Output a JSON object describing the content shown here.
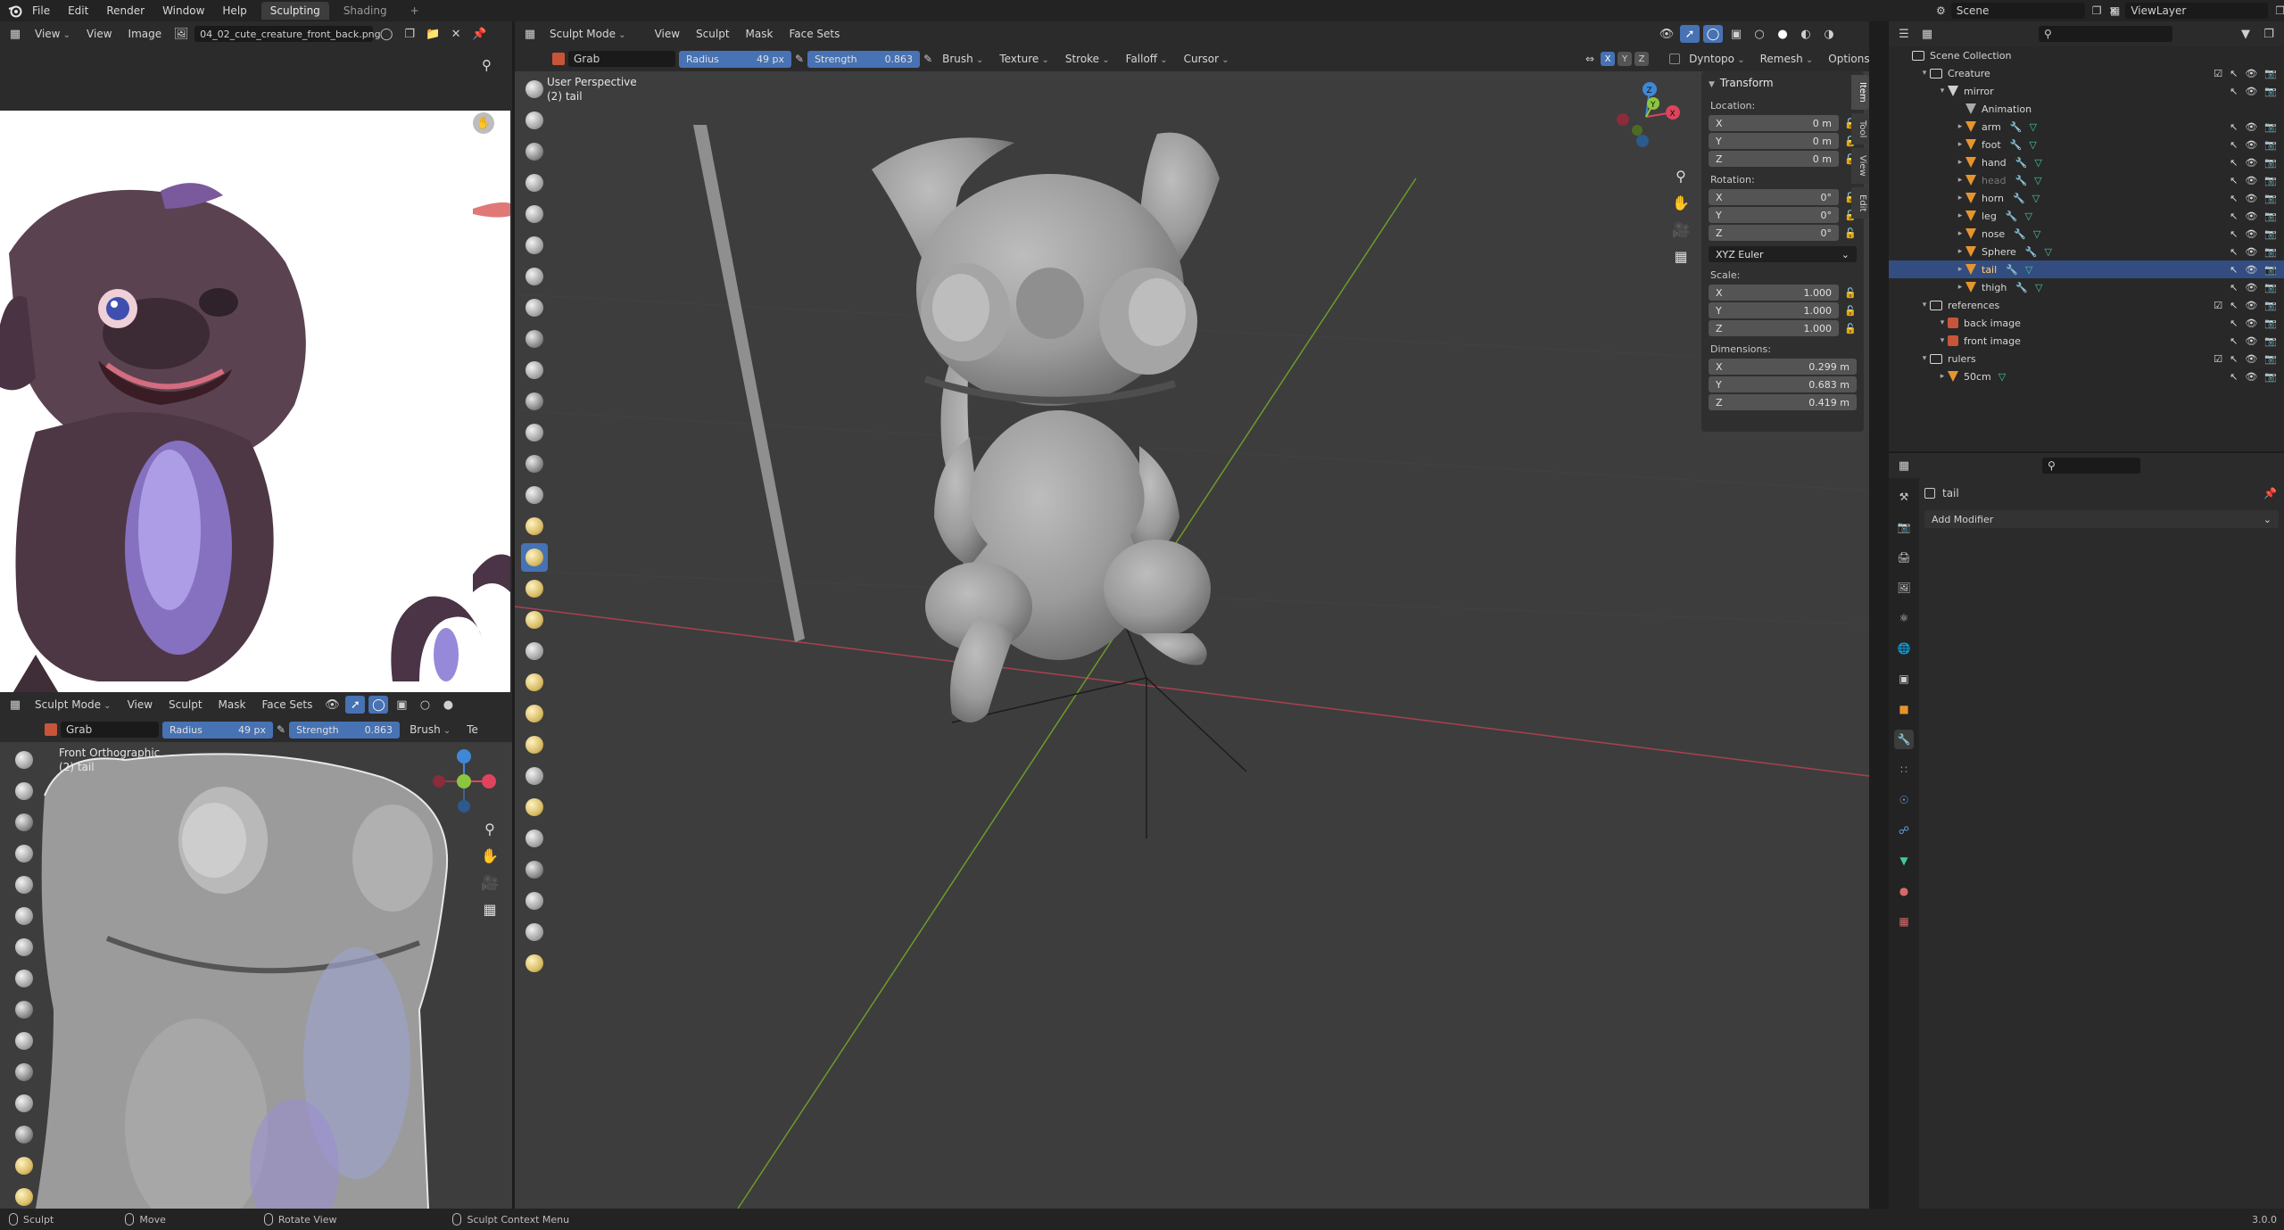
{
  "topbar": {
    "menus": [
      "File",
      "Edit",
      "Render",
      "Window",
      "Help"
    ],
    "workspace_tabs": [
      "Sculpting",
      "Shading"
    ],
    "add_tab": "+",
    "scene": "Scene",
    "view_layer": "ViewLayer"
  },
  "image_editor": {
    "view": "View",
    "menus": [
      "View",
      "Image"
    ],
    "image_name": "04_02_cute_creature_front_back.png"
  },
  "small_viewport": {
    "mode": "Sculpt Mode",
    "menus": [
      "View",
      "Sculpt",
      "Mask",
      "Face Sets"
    ],
    "brush": "Grab",
    "radius_label": "Radius",
    "radius_value": "49 px",
    "strength_label": "Strength",
    "strength_value": "0.863",
    "brush_menu": "Brush",
    "texture_menu": "Te",
    "view_name": "Front Orthographic",
    "object_name": "(2) tail"
  },
  "main_viewport": {
    "mode": "Sculpt Mode",
    "menus": [
      "View",
      "Sculpt",
      "Mask",
      "Face Sets"
    ],
    "brush": "Grab",
    "radius_label": "Radius",
    "radius_value": "49 px",
    "strength_label": "Strength",
    "strength_value": "0.863",
    "dropdowns": [
      "Brush",
      "Texture",
      "Stroke",
      "Falloff",
      "Cursor"
    ],
    "symmetry": [
      "X",
      "Y",
      "Z"
    ],
    "dyntopo": "Dyntopo",
    "remesh": "Remesh",
    "options": "Options",
    "view_name": "User Perspective",
    "object_name": "(2) tail"
  },
  "transform_panel": {
    "title": "Transform",
    "location_label": "Location:",
    "location": [
      {
        "axis": "X",
        "value": "0 m"
      },
      {
        "axis": "Y",
        "value": "0 m"
      },
      {
        "axis": "Z",
        "value": "0 m"
      }
    ],
    "rotation_label": "Rotation:",
    "rotation": [
      {
        "axis": "X",
        "value": "0°"
      },
      {
        "axis": "Y",
        "value": "0°"
      },
      {
        "axis": "Z",
        "value": "0°"
      }
    ],
    "rotation_mode": "XYZ Euler",
    "scale_label": "Scale:",
    "scale": [
      {
        "axis": "X",
        "value": "1.000"
      },
      {
        "axis": "Y",
        "value": "1.000"
      },
      {
        "axis": "Z",
        "value": "1.000"
      }
    ],
    "dimensions_label": "Dimensions:",
    "dimensions": [
      {
        "axis": "X",
        "value": "0.299 m"
      },
      {
        "axis": "Y",
        "value": "0.683 m"
      },
      {
        "axis": "Z",
        "value": "0.419 m"
      }
    ]
  },
  "sidebar_tabs": [
    "Item",
    "Tool",
    "View",
    "Edit"
  ],
  "gizmo": {
    "x": "X",
    "y": "Y",
    "z": "Z"
  },
  "outliner": {
    "rows": [
      {
        "label": "Scene Collection",
        "kind": "root"
      },
      {
        "label": "Creature",
        "kind": "collection"
      },
      {
        "label": "mirror",
        "kind": "empty"
      },
      {
        "label": "Animation",
        "kind": "anim"
      },
      {
        "label": "arm",
        "kind": "mesh"
      },
      {
        "label": "foot",
        "kind": "mesh"
      },
      {
        "label": "hand",
        "kind": "mesh"
      },
      {
        "label": "head",
        "kind": "mesh-muted"
      },
      {
        "label": "horn",
        "kind": "mesh"
      },
      {
        "label": "leg",
        "kind": "mesh"
      },
      {
        "label": "nose",
        "kind": "mesh"
      },
      {
        "label": "Sphere",
        "kind": "mesh"
      },
      {
        "label": "tail",
        "kind": "mesh-selected"
      },
      {
        "label": "thigh",
        "kind": "mesh"
      },
      {
        "label": "references",
        "kind": "collection"
      },
      {
        "label": "back image",
        "kind": "image"
      },
      {
        "label": "front image",
        "kind": "image"
      },
      {
        "label": "rulers",
        "kind": "collection"
      },
      {
        "label": "50cm",
        "kind": "mesh"
      }
    ]
  },
  "properties": {
    "object_name": "tail",
    "add_modifier": "Add Modifier"
  },
  "statusbar": {
    "items": [
      "Sculpt",
      "Move",
      "Rotate View",
      "Sculpt Context Menu"
    ],
    "version": "3.0.0"
  },
  "colors": {
    "accent": "#4772b3",
    "selection": "#334d80",
    "x_axis": "#e0435c",
    "y_axis": "#8cc63f",
    "z_axis": "#3f88d8"
  }
}
